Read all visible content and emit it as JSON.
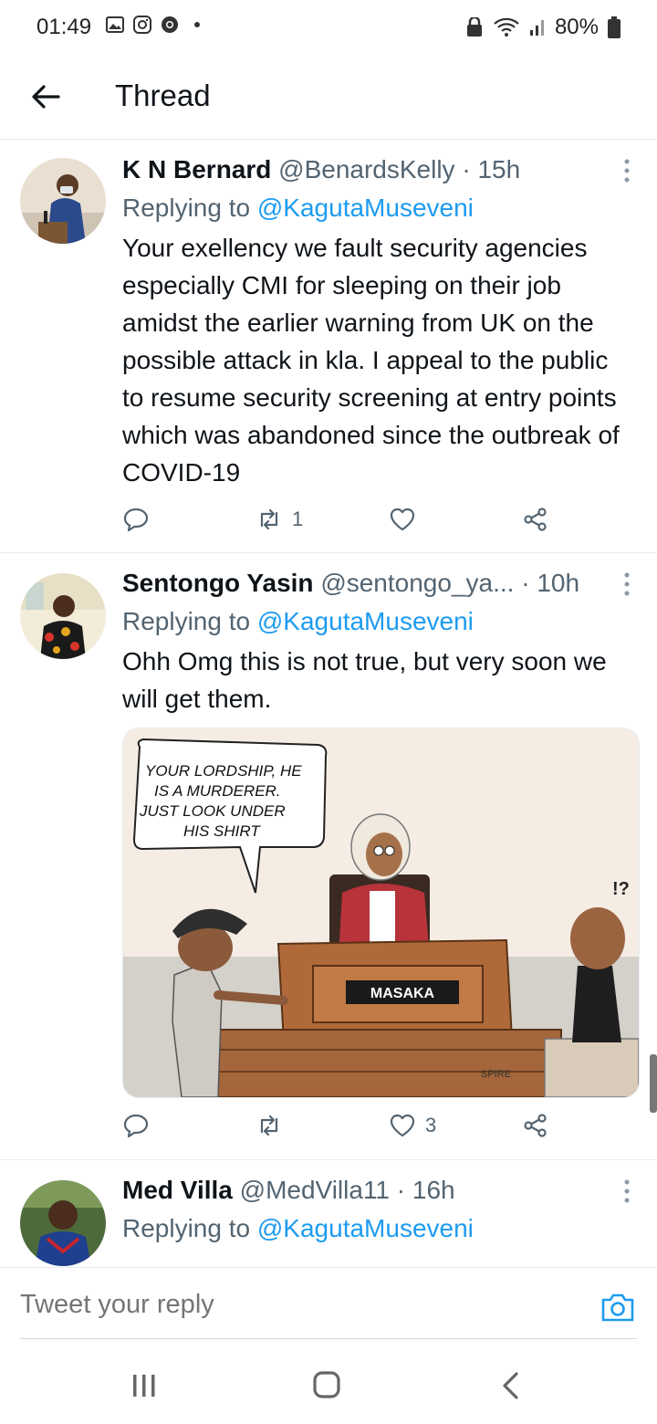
{
  "status": {
    "time": "01:49",
    "battery": "80%"
  },
  "header": {
    "title": "Thread"
  },
  "tweets": [
    {
      "name": "K N Bernard",
      "handle": "@BenardsKelly",
      "time": "15h",
      "replying_prefix": "Replying to",
      "replying_to": "@KagutaMuseveni",
      "text": "Your exellency we fault security agencies especially CMI for sleeping on their job amidst the earlier warning from UK on the possible attack in kla. I appeal to the public to resume security screening at entry points which was abandoned since the outbreak of COVID-19",
      "retweets": "1",
      "likes": ""
    },
    {
      "name": "Sentongo Yasin",
      "handle": "@sentongo_ya...",
      "time": "10h",
      "replying_prefix": "Replying to",
      "replying_to": "@KagutaMuseveni",
      "text": "Ohh Omg this is not true, but very soon we will get them.",
      "retweets": "",
      "likes": "3",
      "cartoon": {
        "speech_lines": [
          "YOUR LORDSHIP, HE",
          "IS A MURDERER.",
          "JUST LOOK UNDER",
          "HIS SHIRT"
        ],
        "bench_sign": "MASAKA",
        "signature": "SPIRE",
        "exclaim": "!?"
      }
    },
    {
      "name": "Med Villa",
      "handle": "@MedVilla11",
      "time": "16h",
      "replying_prefix": "Replying to",
      "replying_to": "@KagutaMuseveni"
    }
  ],
  "reply": {
    "placeholder": "Tweet your reply"
  },
  "colors": {
    "accent": "#1d9bf0",
    "secondary_text": "#536471",
    "primary_text": "#0f1419",
    "divider": "#e6ecf0"
  }
}
